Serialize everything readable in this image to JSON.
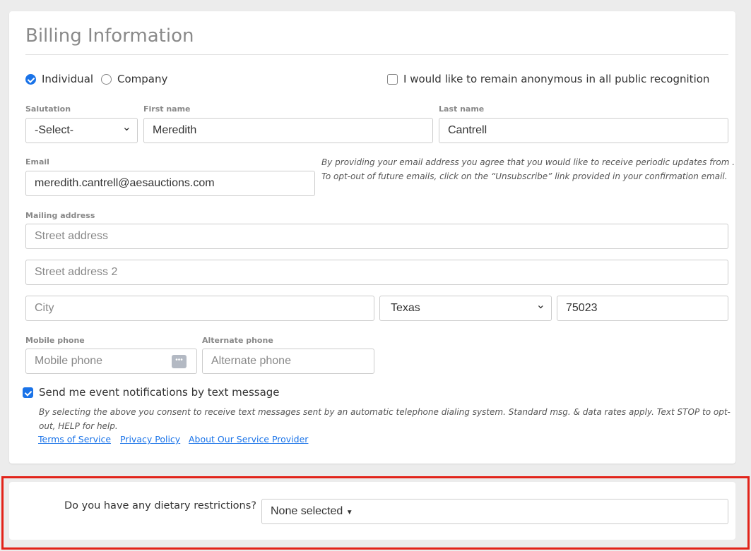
{
  "title": "Billing Information",
  "donor_type": {
    "options": [
      "Individual",
      "Company"
    ],
    "selected": "Individual"
  },
  "anonymous_label": "I would like to remain anonymous in all public recognition",
  "fields": {
    "salutation": {
      "label": "Salutation",
      "value": "-Select-"
    },
    "first_name": {
      "label": "First name",
      "value": "Meredith"
    },
    "last_name": {
      "label": "Last name",
      "value": "Cantrell"
    },
    "email": {
      "label": "Email",
      "value": "meredith.cantrell@aesauctions.com"
    },
    "mailing_label": "Mailing address",
    "street": {
      "placeholder": "Street address"
    },
    "street2": {
      "placeholder": "Street address 2"
    },
    "city": {
      "placeholder": "City"
    },
    "state": {
      "value": "Texas"
    },
    "zip": {
      "value": "75023"
    },
    "mobile": {
      "label": "Mobile phone",
      "placeholder": "Mobile phone"
    },
    "alt": {
      "label": "Alternate phone",
      "placeholder": "Alternate phone"
    }
  },
  "email_note": [
    "By providing your email address you agree that you would like to receive periodic updates from .",
    "To opt-out of future emails, click on the “Unsubscribe” link provided in your confirmation email."
  ],
  "sms": {
    "label": "Send me event notifications by text message",
    "checked": true,
    "note": "By selecting the above you consent to receive text messages sent by an automatic telephone dialing system. Standard msg. & data rates apply. Text STOP to opt-out, HELP for help.",
    "links": [
      "Terms of Service",
      "Privacy Policy",
      "About Our Service Provider"
    ]
  },
  "dietary": {
    "question": "Do you have any dietary restrictions?",
    "value": "None selected"
  },
  "colors": {
    "accent": "#1a73e8",
    "highlight": "#e2231a"
  }
}
